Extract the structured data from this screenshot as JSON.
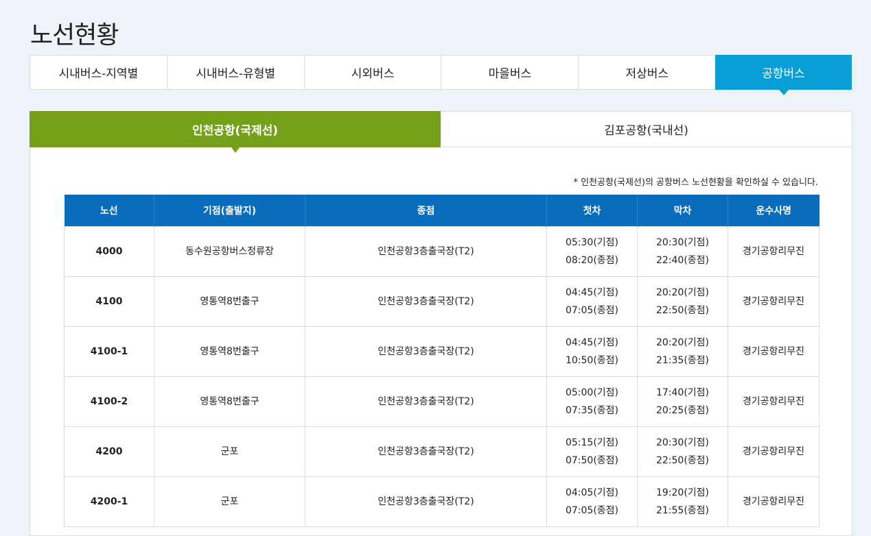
{
  "page_title": "노선현황",
  "main_tabs": [
    {
      "label": "시내버스-지역별",
      "active": false
    },
    {
      "label": "시내버스-유형별",
      "active": false
    },
    {
      "label": "시외버스",
      "active": false
    },
    {
      "label": "마을버스",
      "active": false
    },
    {
      "label": "저상버스",
      "active": false
    },
    {
      "label": "공항버스",
      "active": true
    }
  ],
  "sub_tabs": [
    {
      "label": "인천공항(국제선)",
      "active": true
    },
    {
      "label": "김포공항(국내선)",
      "active": false
    }
  ],
  "notice": "* 인천공항(국제선)의 공항버스 노선현황을 확인하실 수 있습니다.",
  "colors": {
    "main_tab_active": "#099fd6",
    "sub_tab_active": "#74a01a",
    "table_header": "#0a6cbd"
  },
  "table": {
    "headers": [
      "노선",
      "기점(출발지)",
      "종점",
      "첫차",
      "막차",
      "운수사명"
    ],
    "rows": [
      {
        "route": "4000",
        "start": "동수원공항버스정류장",
        "end": "인천공항3층출국장(T2)",
        "first1": "05:30(기점)",
        "first2": "08:20(종점)",
        "last1": "20:30(기점)",
        "last2": "22:40(종점)",
        "company": "경기공항리무진"
      },
      {
        "route": "4100",
        "start": "영통역8번출구",
        "end": "인천공항3층출국장(T2)",
        "first1": "04:45(기점)",
        "first2": "07:05(종점)",
        "last1": "20:20(기점)",
        "last2": "22:50(종점)",
        "company": "경기공항리무진"
      },
      {
        "route": "4100-1",
        "start": "영통역8번출구",
        "end": "인천공항3층출국장(T2)",
        "first1": "04:45(기점)",
        "first2": "10:50(종점)",
        "last1": "20:20(기점)",
        "last2": "21:35(종점)",
        "company": "경기공항리무진"
      },
      {
        "route": "4100-2",
        "start": "영통역8번출구",
        "end": "인천공항3층출국장(T2)",
        "first1": "05:00(기점)",
        "first2": "07:35(종점)",
        "last1": "17:40(기점)",
        "last2": "20:25(종점)",
        "company": "경기공항리무진"
      },
      {
        "route": "4200",
        "start": "군포",
        "end": "인천공항3층출국장(T2)",
        "first1": "05:15(기점)",
        "first2": "07:50(종점)",
        "last1": "20:30(기점)",
        "last2": "22:50(종점)",
        "company": "경기공항리무진"
      },
      {
        "route": "4200-1",
        "start": "군포",
        "end": "인천공항3층출국장(T2)",
        "first1": "04:05(기점)",
        "first2": "07:05(종점)",
        "last1": "19:20(기점)",
        "last2": "21:55(종점)",
        "company": "경기공항리무진"
      }
    ]
  }
}
